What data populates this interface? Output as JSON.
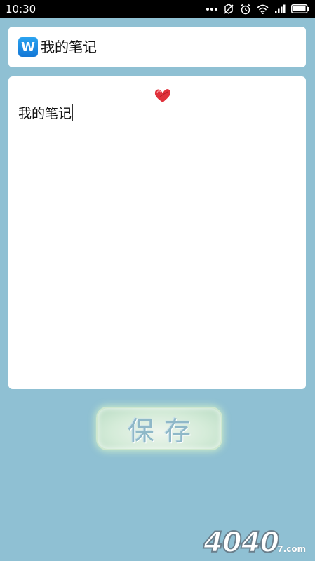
{
  "status_bar": {
    "time": "10:30",
    "icons": [
      "more-icon",
      "signal-off-icon",
      "alarm-icon",
      "wifi-icon",
      "cell-signal-icon",
      "battery-icon"
    ]
  },
  "title_bar": {
    "app_icon_letter": "W",
    "title_value": "我的笔记"
  },
  "note": {
    "content": "我的笔记"
  },
  "save_button": {
    "label": "保存"
  },
  "watermark": {
    "text": "4040",
    "suffix": "7.com"
  },
  "colors": {
    "background": "#8fc0d3",
    "card": "#ffffff",
    "status_bar": "#000000",
    "app_icon": "#1a8be6",
    "heart": "#e0313b"
  }
}
